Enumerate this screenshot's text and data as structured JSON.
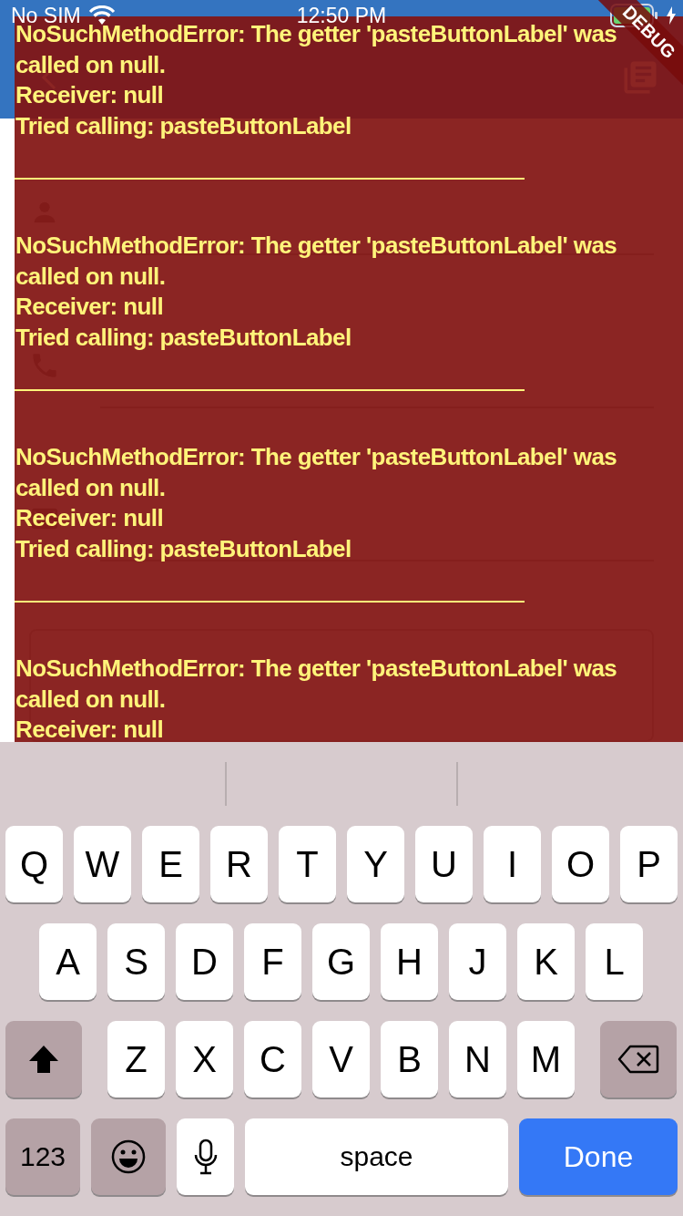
{
  "status_bar": {
    "carrier": "No SIM",
    "time": "12:50 PM"
  },
  "debug_banner": "DEBUG",
  "form": {
    "fields": [
      {
        "kind": "underline"
      },
      {
        "kind": "underline"
      },
      {
        "kind": "underline"
      },
      {
        "kind": "outlined"
      }
    ]
  },
  "errors": [
    {
      "lines": [
        "NoSuchMethodError: The getter 'pasteButtonLabel' was",
        "called on null.",
        "Receiver: null",
        "Tried calling: pasteButtonLabel"
      ]
    },
    {
      "lines": [
        "NoSuchMethodError: The getter 'pasteButtonLabel' was",
        "called on null.",
        "Receiver: null",
        "Tried calling: pasteButtonLabel"
      ]
    },
    {
      "lines": [
        "NoSuchMethodError: The getter 'pasteButtonLabel' was",
        "called on null.",
        "Receiver: null",
        "Tried calling: pasteButtonLabel"
      ]
    },
    {
      "lines": [
        "NoSuchMethodError: The getter 'pasteButtonLabel' was",
        "called on null.",
        "Receiver: null"
      ]
    }
  ],
  "keyboard": {
    "rows": [
      [
        "Q",
        "W",
        "E",
        "R",
        "T",
        "Y",
        "U",
        "I",
        "O",
        "P"
      ],
      [
        "A",
        "S",
        "D",
        "F",
        "G",
        "H",
        "J",
        "K",
        "L"
      ],
      [
        "Z",
        "X",
        "C",
        "V",
        "B",
        "N",
        "M"
      ]
    ],
    "numbers_key": "123",
    "space_key": "space",
    "done_key": "Done"
  }
}
